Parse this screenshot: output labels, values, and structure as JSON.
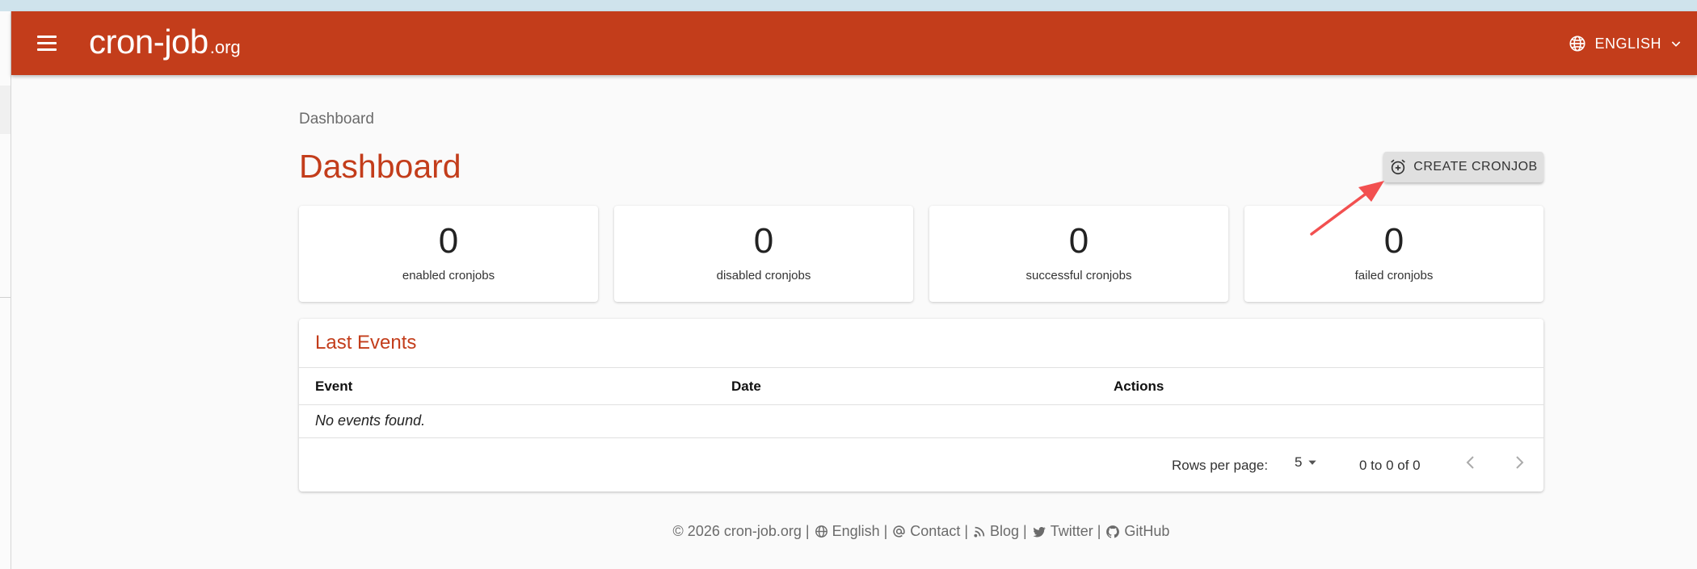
{
  "app": {
    "logo_main": "cron-job",
    "logo_tld": ".org",
    "language": "ENGLISH",
    "colors": {
      "brand": "#c33d1b",
      "background": "#fafafa",
      "arrow": "#f25050"
    }
  },
  "breadcrumb": "Dashboard",
  "page_title": "Dashboard",
  "create_button": {
    "label": "CREATE CRONJOB",
    "icon": "alarm-add-icon"
  },
  "stats": [
    {
      "value": "0",
      "label": "enabled cronjobs"
    },
    {
      "value": "0",
      "label": "disabled cronjobs"
    },
    {
      "value": "0",
      "label": "successful cronjobs"
    },
    {
      "value": "0",
      "label": "failed cronjobs"
    }
  ],
  "events": {
    "title": "Last Events",
    "columns": [
      "Event",
      "Date",
      "Actions"
    ],
    "empty_text": "No events found.",
    "pagination": {
      "rows_per_page_label": "Rows per page:",
      "rows_per_page": "5",
      "range": "0 to 0 of 0"
    }
  },
  "footer": {
    "copyright": "© 2026 cron-job.org |",
    "links": [
      {
        "label": "English |",
        "icon": "globe-icon"
      },
      {
        "label": "Contact |",
        "icon": "at-icon"
      },
      {
        "label": "Blog |",
        "icon": "rss-icon"
      },
      {
        "label": "Twitter |",
        "icon": "twitter-icon"
      },
      {
        "label": "GitHub",
        "icon": "github-icon"
      }
    ]
  }
}
